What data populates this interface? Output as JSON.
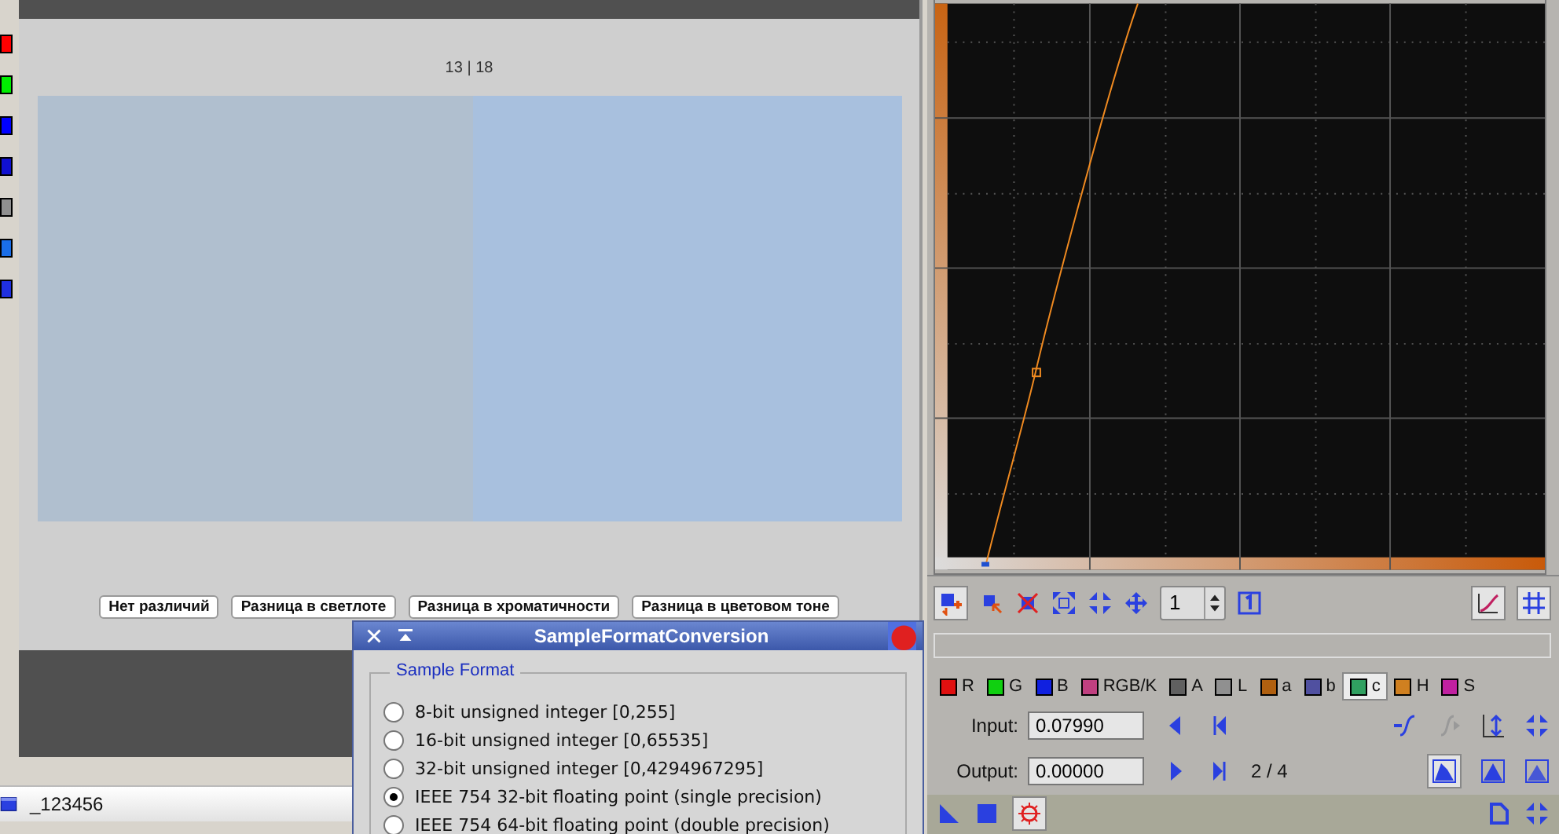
{
  "preview": {
    "counter": "13 | 18",
    "buttons": [
      "Нет различий",
      "Разница в светлоте",
      "Разница в хроматичности",
      "Разница в цветовом тоне"
    ]
  },
  "minimized_window": {
    "title": "_123456"
  },
  "curves": {
    "zoom": "1",
    "channels": [
      {
        "label": "R",
        "color": "#e01010",
        "selected": false
      },
      {
        "label": "G",
        "color": "#10d010",
        "selected": false
      },
      {
        "label": "B",
        "color": "#1020e0",
        "selected": false
      },
      {
        "label": "RGB/K",
        "color": "#c04080",
        "selected": false
      },
      {
        "label": "A",
        "color": "#606060",
        "selected": false
      },
      {
        "label": "L",
        "color": "#909090",
        "selected": false
      },
      {
        "label": "a",
        "color": "#b06010",
        "selected": false
      },
      {
        "label": "b",
        "color": "#5050a0",
        "selected": false
      },
      {
        "label": "c",
        "color": "#30a060",
        "selected": true
      },
      {
        "label": "H",
        "color": "#d08020",
        "selected": false
      },
      {
        "label": "S",
        "color": "#c020a0",
        "selected": false
      }
    ],
    "input": {
      "label": "Input:",
      "value": "0.07990"
    },
    "output": {
      "label": "Output:",
      "value": "0.00000"
    },
    "point_counter": "2 / 4"
  },
  "dialog": {
    "title": "SampleFormatConversion",
    "group": "Sample Format",
    "options": [
      {
        "label": "8-bit unsigned integer [0,255]",
        "selected": false
      },
      {
        "label": "16-bit unsigned integer [0,65535]",
        "selected": false
      },
      {
        "label": "32-bit unsigned integer [0,4294967295]",
        "selected": false
      },
      {
        "label": "IEEE 754 32-bit floating point (single precision)",
        "selected": true
      },
      {
        "label": "IEEE 754 64-bit floating point (double precision)",
        "selected": false
      }
    ]
  }
}
